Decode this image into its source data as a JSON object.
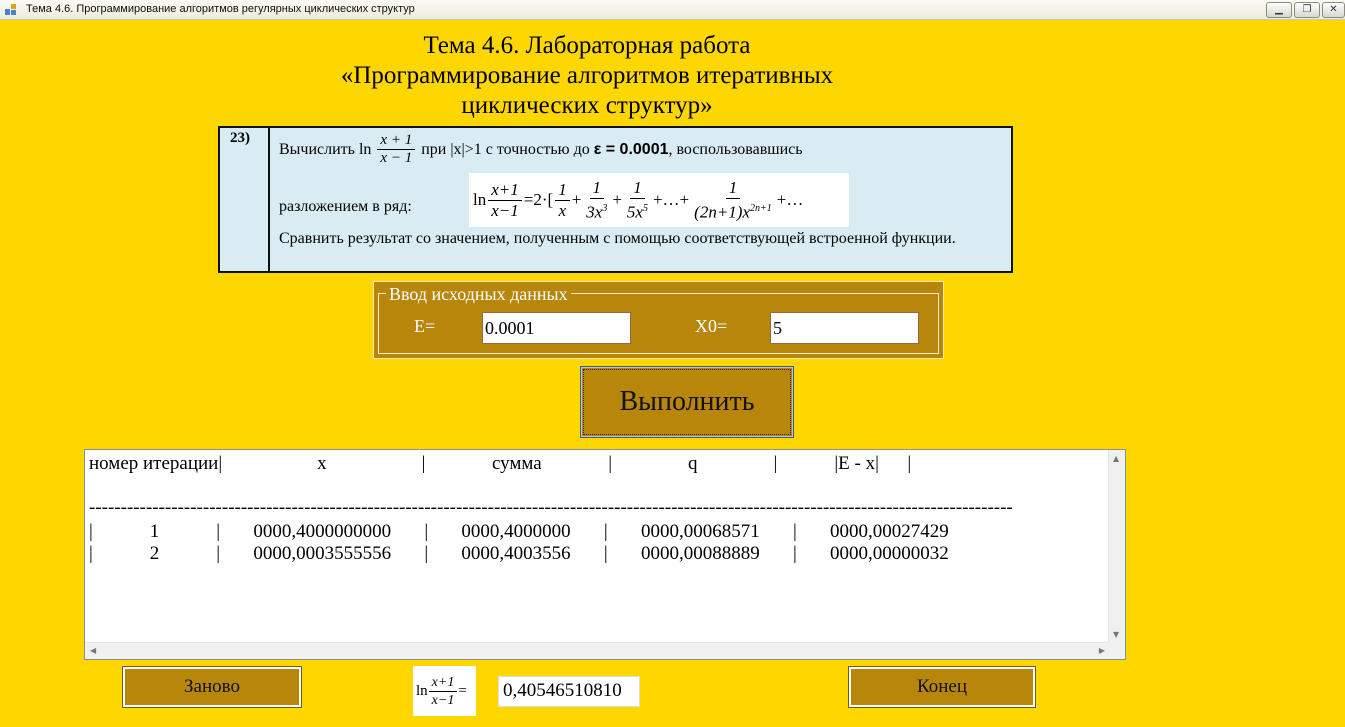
{
  "window": {
    "title": "Тема 4.6. Программирование алгоритмов регулярных циклических структур",
    "minimize_glyph": "▁",
    "maximize_glyph": "❐",
    "close_glyph": "✕"
  },
  "heading": {
    "line1": "Тема 4.6. Лабораторная работа",
    "line2": "«Программирование алгоритмов итеративных",
    "line3": "циклических структур»"
  },
  "task": {
    "number": "23)",
    "line1_prefix": "Вычислить ln",
    "frac_num": "x + 1",
    "frac_den": "x − 1",
    "line1_cond": "при |x|>1  с точностью до",
    "epsilon": "ε = 0.0001",
    "line1_suffix": ", воспользовавшись",
    "line2": "разложением  в ряд:",
    "series": {
      "ln": "ln",
      "lhs_num": "x+1",
      "lhs_den": "x−1",
      "eq": "=2·[",
      "t1_num": "1",
      "t1_den": "x",
      "plus": "+",
      "t2_num": "1",
      "t2_den": "3x",
      "t3_num": "1",
      "t3_den": "5x",
      "dots": "+…+",
      "tn_num": "1",
      "tn_den": "(2n+1)x",
      "exp3": "3",
      "exp5": "5",
      "expn": "2n+1",
      "tail": "+…"
    },
    "line3": "Сравнить результат со значением,  полученным с помощью соответствующей встроенной функции."
  },
  "input_group": {
    "legend": "Ввод исходных данных",
    "e_label": "E=",
    "e_value": "0.0001",
    "x0_label": "X0=",
    "x0_value": "5"
  },
  "execute_label": "Выполнить",
  "output": {
    "header": "номер итерации|                    x                    |              сумма              |                q                |            |E - x|      |",
    "separator": "--------------------------------------------------------------------------------------------------------------------------------------------------",
    "rows": [
      "|            1            |       0000,4000000000       |       0000,4000000       |       0000,00068571       |       0000,00027429",
      "|            2            |       0000,0003555556       |       0000,4003556       |       0000,00088889       |       0000,00000032"
    ]
  },
  "bottom": {
    "again_label": "Заново",
    "end_label": "Конец",
    "ln_label": "ln",
    "ln_num": "x+1",
    "ln_den": "x−1",
    "ln_eq": "=",
    "result_value": "0,40546510810"
  },
  "colors": {
    "background": "#FED700",
    "panel": "#B8860B",
    "task_bg": "#DAECF3"
  }
}
